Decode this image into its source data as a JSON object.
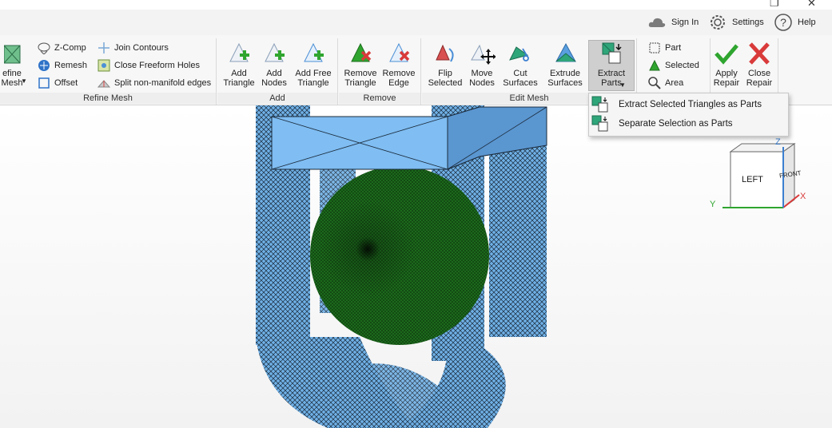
{
  "window": {
    "restore_glyph": "❐",
    "close_glyph": "✕"
  },
  "topbar": {
    "sign_in": "Sign In",
    "settings": "Settings",
    "help": "Help"
  },
  "ribbon": {
    "refine_mesh": {
      "label": "Refine Mesh",
      "big_button": "efine\nMesh",
      "items": [
        "Z-Comp",
        "Remesh",
        "Offset",
        "Join Contours",
        "Close Freeform Holes",
        "Split non-manifold edges"
      ]
    },
    "add": {
      "label": "Add",
      "buttons": [
        "Add\nTriangle",
        "Add\nNodes",
        "Add Free\nTriangle"
      ]
    },
    "remove": {
      "label": "Remove",
      "buttons": [
        "Remove\nTriangle",
        "Remove\nEdge"
      ]
    },
    "edit_mesh": {
      "label": "Edit Mesh",
      "buttons": [
        "Flip\nSelected",
        "Move\nNodes",
        "Cut\nSurfaces",
        "Extrude\nSurfaces",
        "Extract\nParts"
      ]
    },
    "selection": {
      "items": [
        "Part",
        "Selected",
        "Area"
      ]
    },
    "repair": {
      "buttons": [
        "Apply\nRepair",
        "Close\nRepair"
      ]
    }
  },
  "dropdown": {
    "items": [
      "Extract Selected Triangles as Parts",
      "Separate Selection as Parts"
    ]
  },
  "viewcube": {
    "face_left": "LEFT",
    "face_front": "FRONT",
    "axis_x": "X",
    "axis_y": "Y",
    "axis_z": "Z"
  },
  "colors": {
    "accent_green": "#3aa63a",
    "remove_red": "#d93a3a",
    "mesh_blue": "#6fb0e6",
    "sphere_green": "#1c6a1c"
  }
}
